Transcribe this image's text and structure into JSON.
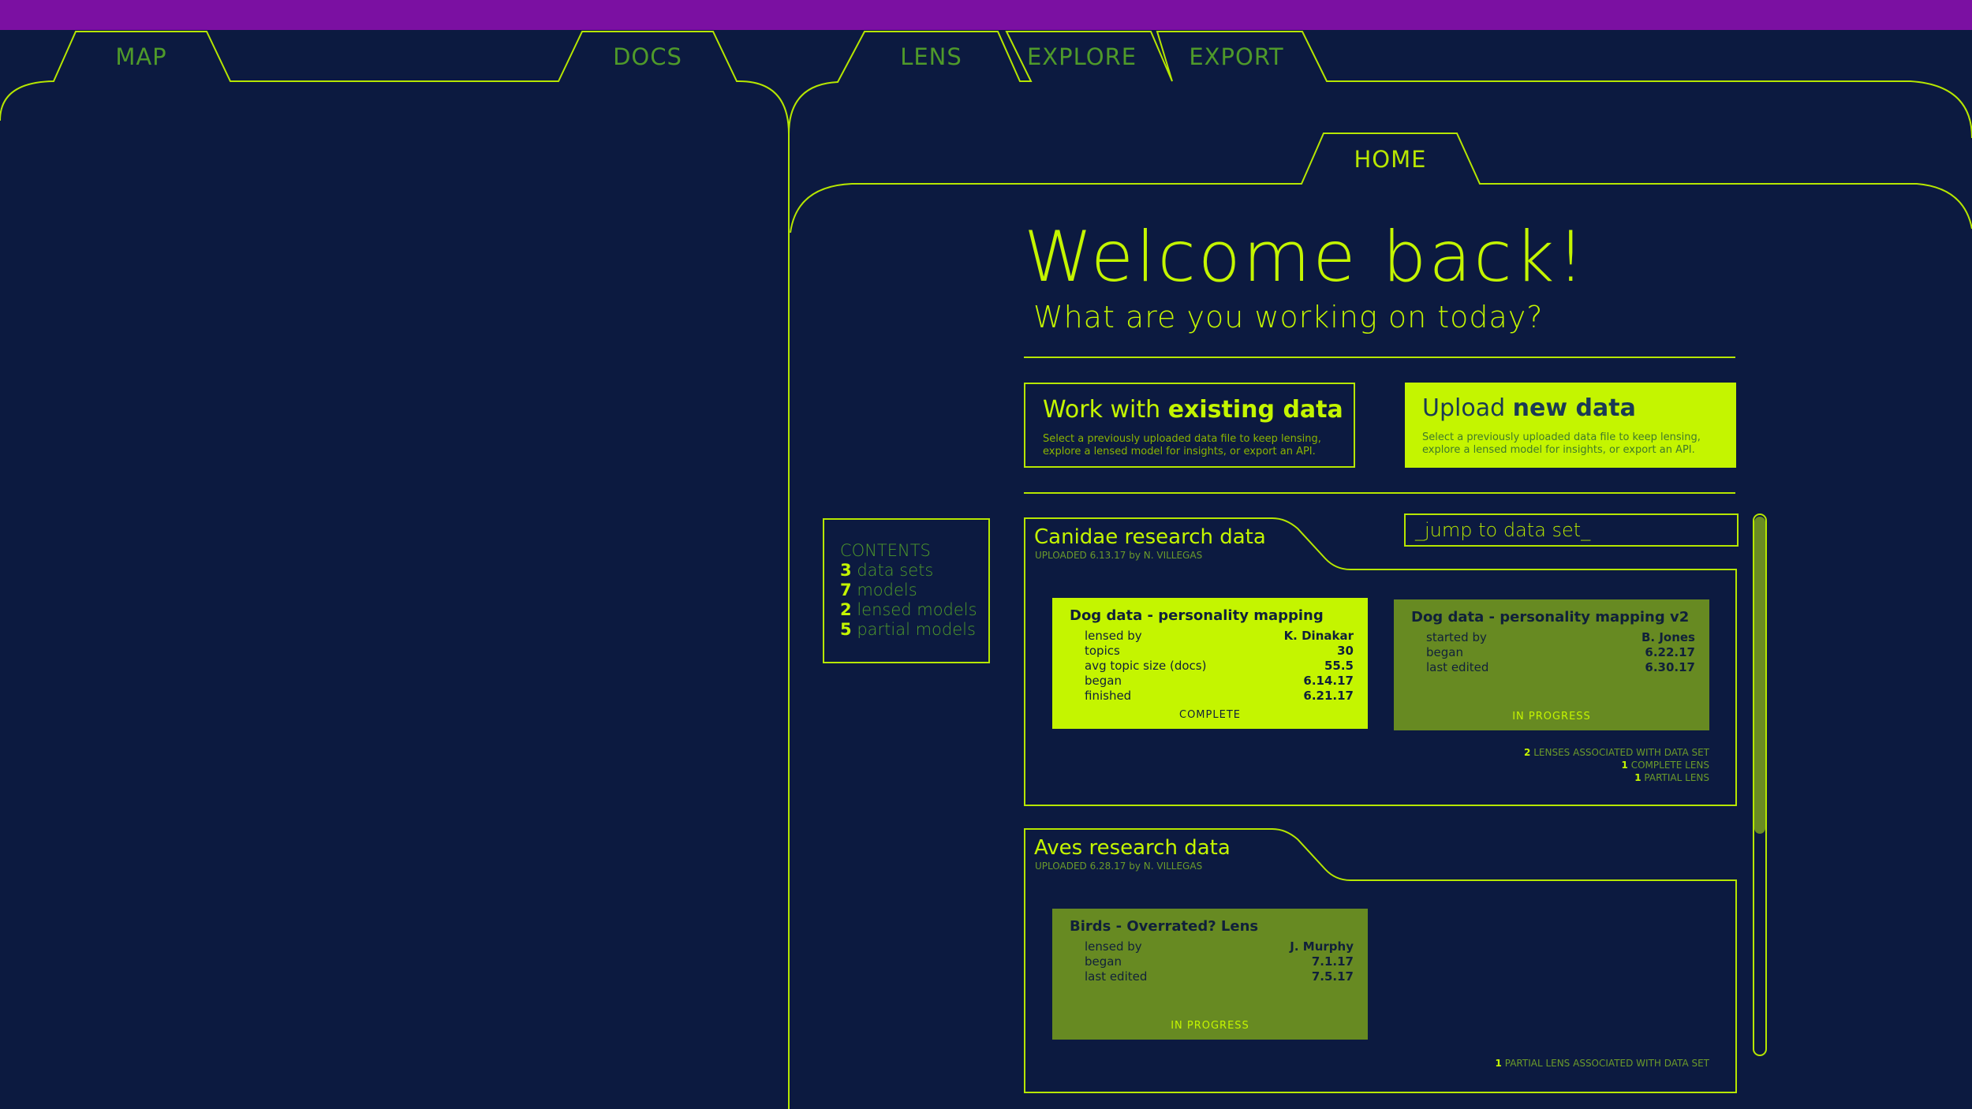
{
  "colors": {
    "background": "#0c1a40",
    "topbar": "#7b10a2",
    "accent": "#c4f500",
    "dim_green": "#678a22"
  },
  "tabs": {
    "map": "MAP",
    "docs": "DOCS",
    "lens": "LENS",
    "explore": "EXPLORE",
    "export": "EXPORT",
    "home": "HOME"
  },
  "welcome": {
    "title": "Welcome back!",
    "subtitle": "What are you working on today?"
  },
  "actions": {
    "existing": {
      "prefix": "Work with",
      "bold": "existing data",
      "desc": "Select a previously uploaded data file to keep lensing, explore a lensed model for insights, or export an API."
    },
    "upload": {
      "prefix": "Upload",
      "bold": "new data",
      "desc": "Select a previously uploaded data file to keep lensing, explore a lensed model for insights, or export an API."
    }
  },
  "contents": {
    "heading": "CONTENTS",
    "items": [
      {
        "count": "3",
        "label": "data sets"
      },
      {
        "count": "7",
        "label": "models"
      },
      {
        "count": "2",
        "label": "lensed models"
      },
      {
        "count": "5",
        "label": "partial models"
      }
    ]
  },
  "search": {
    "placeholder": "_jump to data set_"
  },
  "datasets": [
    {
      "title": "Canidae research data",
      "uploaded": "UPLOADED 6.13.17 by N. VILLEGAS",
      "lenses": [
        {
          "title": "Dog data - personality mapping",
          "rows": [
            {
              "k": "lensed by",
              "v": "K. Dinakar"
            },
            {
              "k": "topics",
              "v": "30"
            },
            {
              "k": "avg topic size (docs)",
              "v": "55.5"
            },
            {
              "k": "began",
              "v": "6.14.17"
            },
            {
              "k": "finished",
              "v": "6.21.17"
            }
          ],
          "status": "COMPLETE"
        },
        {
          "title": "Dog data - personality mapping v2",
          "rows": [
            {
              "k": "started by",
              "v": "B. Jones"
            },
            {
              "k": "began",
              "v": "6.22.17"
            },
            {
              "k": "last edited",
              "v": "6.30.17"
            }
          ],
          "status": "IN PROGRESS"
        }
      ],
      "assoc": [
        {
          "n": "2",
          "text": "LENSES ASSOCIATED WITH DATA SET"
        },
        {
          "n": "1",
          "text": "COMPLETE LENS"
        },
        {
          "n": "1",
          "text": "PARTIAL LENS"
        }
      ]
    },
    {
      "title": "Aves research data",
      "uploaded": "UPLOADED 6.28.17 by N. VILLEGAS",
      "lenses": [
        {
          "title": "Birds - Overrated? Lens",
          "rows": [
            {
              "k": "lensed by",
              "v": "J. Murphy"
            },
            {
              "k": "began",
              "v": "7.1.17"
            },
            {
              "k": "last edited",
              "v": "7.5.17"
            }
          ],
          "status": "IN PROGRESS"
        }
      ],
      "assoc": [
        {
          "n": "1",
          "text": "PARTIAL LENS ASSOCIATED WITH DATA SET"
        }
      ]
    }
  ]
}
